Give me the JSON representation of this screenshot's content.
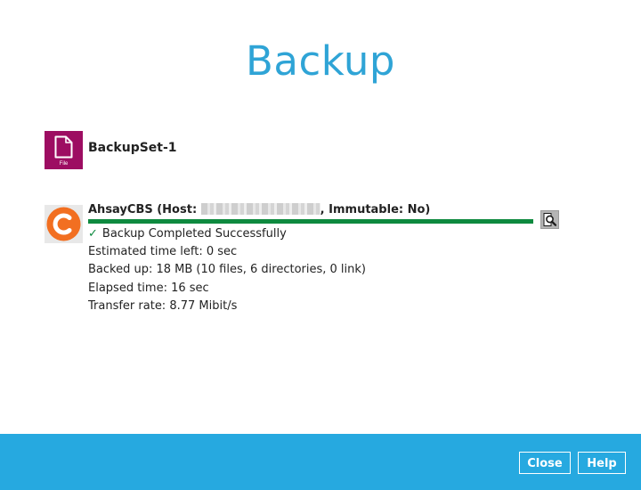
{
  "page": {
    "title": "Backup"
  },
  "backup_set": {
    "icon": "file-icon",
    "icon_label": "File",
    "icon_color": "#9d0d62",
    "name": "BackupSet-1"
  },
  "destination": {
    "icon": "ahsay-cbs-logo",
    "icon_color": "#f26f21",
    "name_prefix": "AhsayCBS (Host: ",
    "name_suffix": ", Immutable: No)",
    "progress": 1.0,
    "progress_color": "#0e8a3f",
    "status": "Backup Completed Successfully",
    "estimated_time_left": "Estimated time left: 0 sec",
    "backed_up": "Backed up: 18 MB (10 files, 6 directories, 0 link)",
    "elapsed_time": "Elapsed time: 16 sec",
    "transfer_rate": "Transfer rate: 8.77 Mibit/s"
  },
  "footer": {
    "background": "#26a9e0",
    "close_label": "Close",
    "help_label": "Help"
  },
  "colors": {
    "title": "#2fa4d6"
  }
}
